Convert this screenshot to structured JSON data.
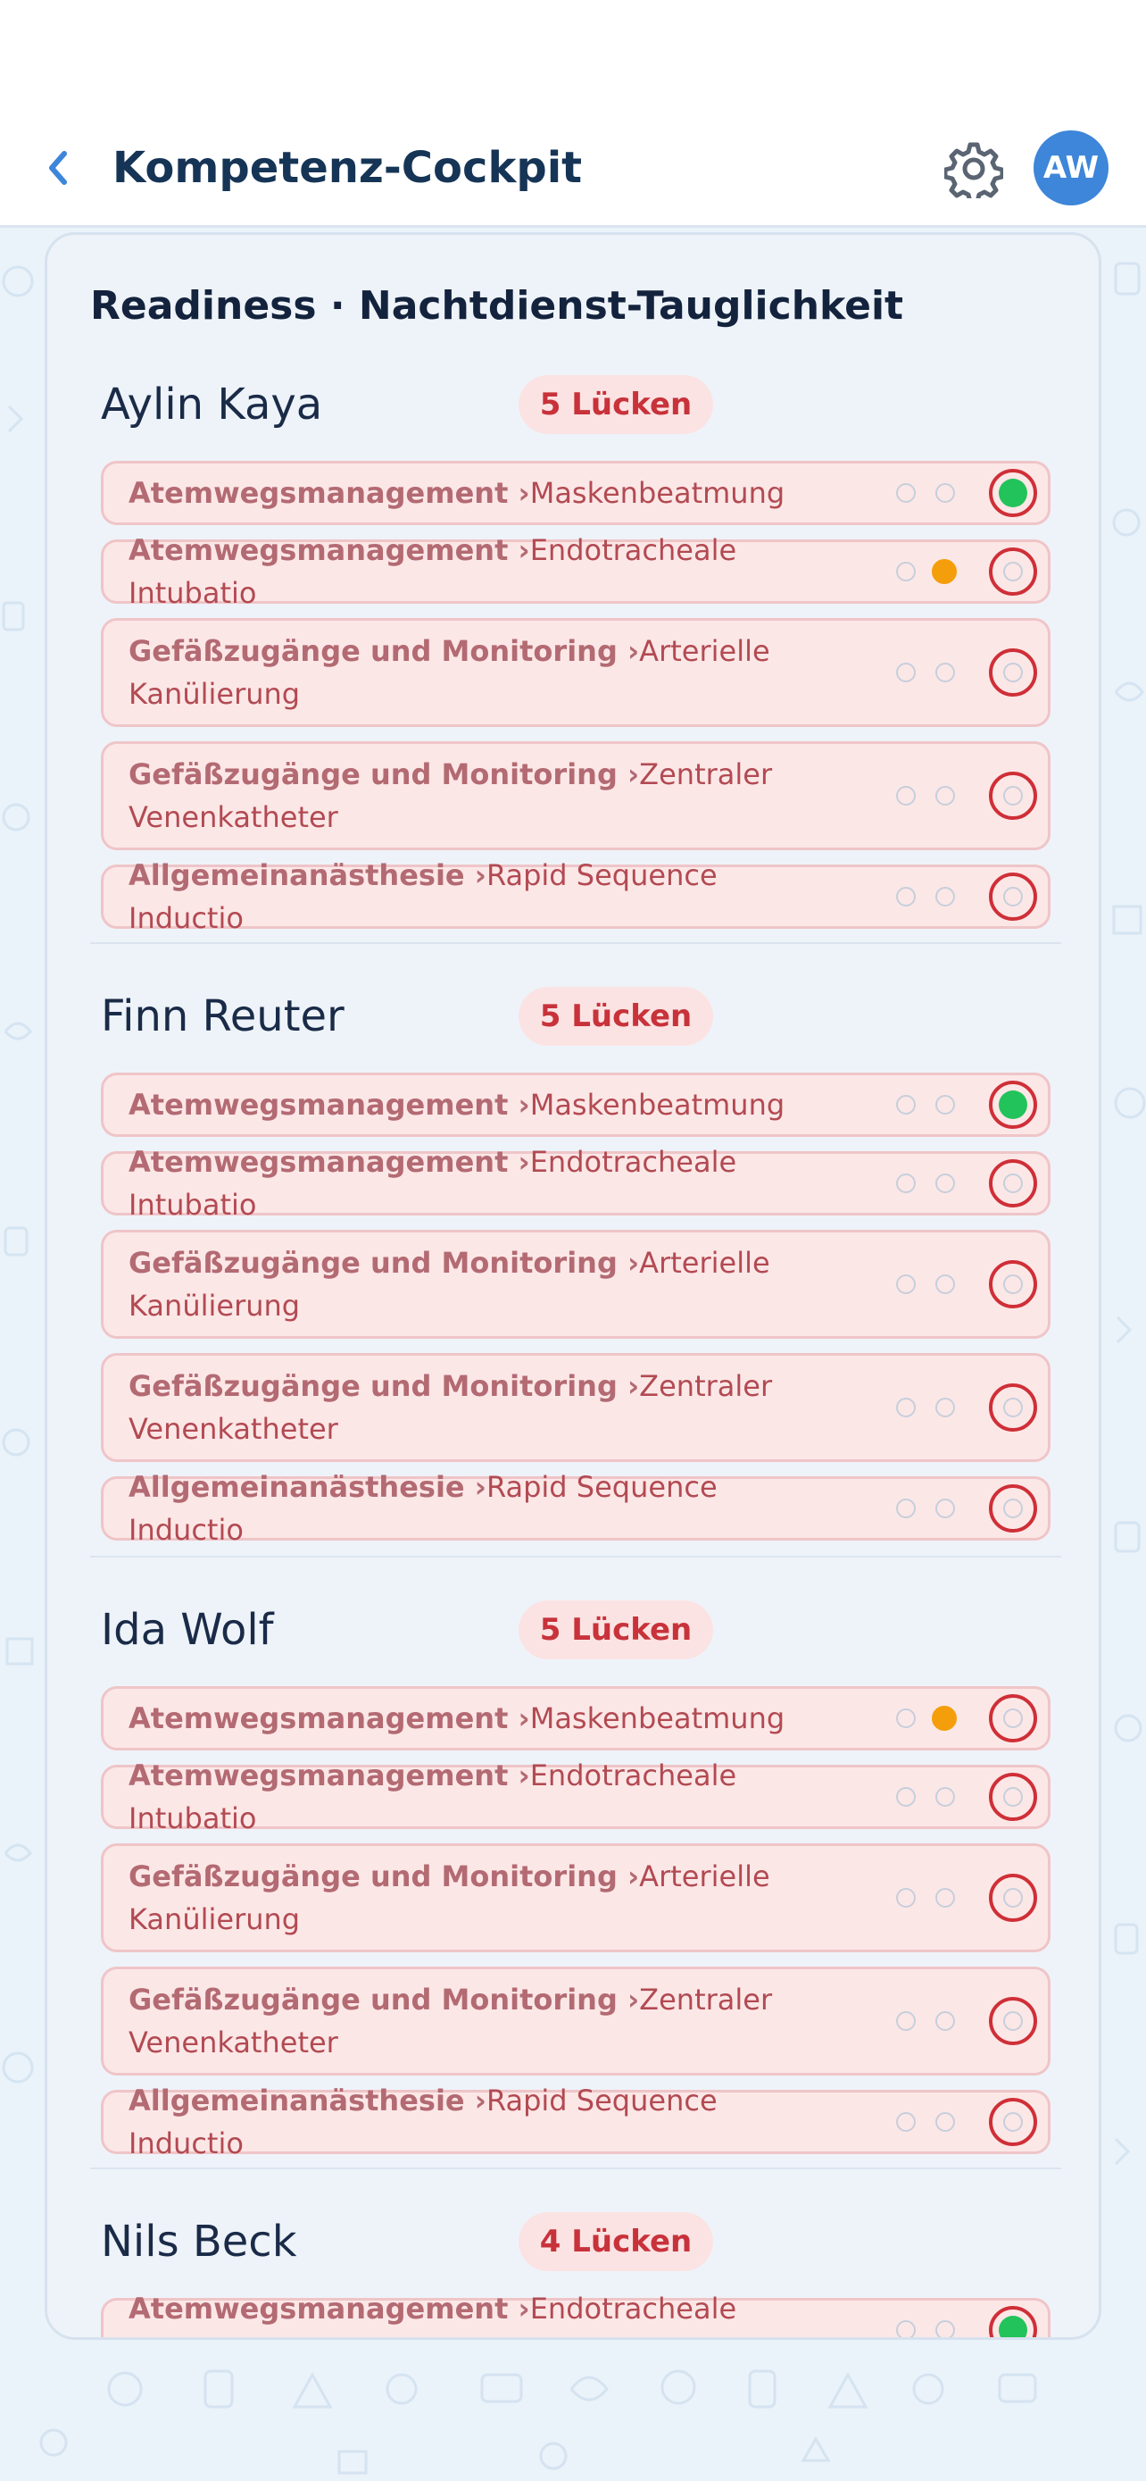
{
  "header": {
    "title": "Kompetenz-Cockpit",
    "avatar_initials": "AW"
  },
  "card": {
    "title": "Readiness · Nachtdienst-Tauglichkeit"
  },
  "people": [
    {
      "name": "Aylin Kaya",
      "badge": "5 Lücken",
      "items": [
        {
          "area": "Atemwegsmanagement ›",
          "skill": "Maskenbeatmung",
          "level": "green",
          "lines": 1
        },
        {
          "area": "Atemwegsmanagement ›",
          "skill": "Endotracheale Intubatio",
          "level": "orange",
          "lines": 1
        },
        {
          "area": "Gefäßzugänge und Monitoring ›",
          "skill": "Arterielle Kanülierung",
          "level": "none",
          "lines": 2
        },
        {
          "area": "Gefäßzugänge und Monitoring ›",
          "skill": "Zentraler Venenkatheter",
          "level": "none",
          "lines": 2
        },
        {
          "area": "Allgemeinanästhesie ›",
          "skill": "Rapid Sequence Inductio",
          "level": "none",
          "lines": 1
        }
      ]
    },
    {
      "name": "Finn Reuter",
      "badge": "5 Lücken",
      "items": [
        {
          "area": "Atemwegsmanagement ›",
          "skill": "Maskenbeatmung",
          "level": "green",
          "lines": 1
        },
        {
          "area": "Atemwegsmanagement ›",
          "skill": "Endotracheale Intubatio",
          "level": "none",
          "lines": 1
        },
        {
          "area": "Gefäßzugänge und Monitoring ›",
          "skill": "Arterielle Kanülierung",
          "level": "none",
          "lines": 2
        },
        {
          "area": "Gefäßzugänge und Monitoring ›",
          "skill": "Zentraler Venenkatheter",
          "level": "none",
          "lines": 2
        },
        {
          "area": "Allgemeinanästhesie ›",
          "skill": "Rapid Sequence Inductio",
          "level": "none",
          "lines": 1
        }
      ]
    },
    {
      "name": "Ida Wolf",
      "badge": "5 Lücken",
      "items": [
        {
          "area": "Atemwegsmanagement ›",
          "skill": "Maskenbeatmung",
          "level": "orange",
          "lines": 1
        },
        {
          "area": "Atemwegsmanagement ›",
          "skill": "Endotracheale Intubatio",
          "level": "none",
          "lines": 1
        },
        {
          "area": "Gefäßzugänge und Monitoring ›",
          "skill": "Arterielle Kanülierung",
          "level": "none",
          "lines": 2
        },
        {
          "area": "Gefäßzugänge und Monitoring ›",
          "skill": "Zentraler Venenkatheter",
          "level": "none",
          "lines": 2
        },
        {
          "area": "Allgemeinanästhesie ›",
          "skill": "Rapid Sequence Inductio",
          "level": "none",
          "lines": 1
        }
      ]
    },
    {
      "name": "Nils Beck",
      "badge": "4 Lücken",
      "items": [
        {
          "area": "Atemwegsmanagement ›",
          "skill": "Endotracheale Intubatio",
          "level": "green",
          "lines": 1
        }
      ]
    }
  ],
  "colors": {
    "accent": "#3d86d9",
    "gap_red": "#cf2f37",
    "partial_orange": "#f59e0b",
    "ok_green": "#22c35a"
  },
  "icons": {
    "back": "chevron-left-icon",
    "settings": "gear-icon"
  }
}
